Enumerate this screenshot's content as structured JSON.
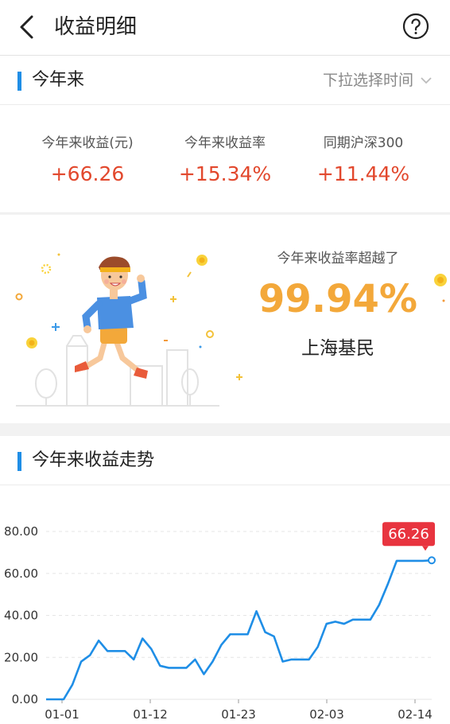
{
  "header": {
    "title": "收益明细",
    "back_icon": "back-arrow-icon",
    "help_icon": "question-mark-icon"
  },
  "period_section": {
    "title": "今年来",
    "picker_label": "下拉选择时间",
    "picker_icon": "chevron-down-icon"
  },
  "stats": [
    {
      "label": "今年来收益(元)",
      "value": "+66.26"
    },
    {
      "label": "今年来收益率",
      "value": "+15.34%"
    },
    {
      "label": "同期沪深300",
      "value": "+11.44%"
    }
  ],
  "beat": {
    "label": "今年来收益率超越了",
    "percent": "99.94%",
    "who": "上海基民"
  },
  "trend_section": {
    "title": "今年来收益走势"
  },
  "colors": {
    "accent_bar": "#1f8ee6",
    "gain": "#e2482d",
    "beat": "#f3a83a",
    "line": "#1f8ee6",
    "badge": "#e8343f"
  },
  "chart_data": {
    "type": "line",
    "x_ticks": [
      "01-01",
      "01-12",
      "01-23",
      "02-03",
      "02-14"
    ],
    "y_ticks": [
      "80.00",
      "60.00",
      "40.00",
      "20.00",
      "0.00"
    ],
    "ylim": [
      0,
      80
    ],
    "grid": true,
    "end_label": "66.26",
    "series": [
      {
        "values": [
          0,
          0,
          0,
          7,
          18,
          21,
          28,
          23,
          23,
          23,
          19,
          29,
          24,
          16,
          15,
          15,
          15,
          19,
          12,
          18,
          26,
          31,
          31,
          31,
          42,
          32,
          30,
          18,
          19,
          19,
          19,
          25,
          36,
          37,
          36,
          38,
          38,
          38,
          45,
          55,
          66,
          66,
          66,
          66,
          66.26
        ]
      }
    ]
  }
}
